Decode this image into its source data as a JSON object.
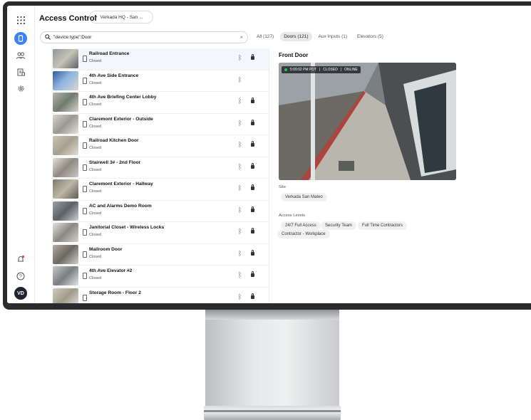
{
  "header": {
    "title": "Access Control",
    "site_selector": "Verkada HQ - San ..."
  },
  "search": {
    "value": "\"device type\":Door",
    "clear_symbol": "×"
  },
  "tabs": [
    {
      "label": "All (127)"
    },
    {
      "label": "Doors (121)"
    },
    {
      "label": "Aux Inputs (1)"
    },
    {
      "label": "Elevators (5)"
    }
  ],
  "sidebar": {
    "avatar_initials": "VD",
    "icons": [
      "apps-grid-icon",
      "access-control-icon",
      "users-icon",
      "reports-icon",
      "settings-icon",
      "alerts-icon",
      "help-icon"
    ]
  },
  "doors": [
    {
      "name": "Railroad Entrance",
      "status": "Closed",
      "locked": true
    },
    {
      "name": "4th Ave Side Entrance",
      "status": "Closed",
      "locked": false
    },
    {
      "name": "4th Ave Briefing Center Lobby",
      "status": "Closed",
      "locked": true
    },
    {
      "name": "Claremont Exterior - Outside",
      "status": "Closed",
      "locked": true
    },
    {
      "name": "Railroad Kitchen Door",
      "status": "Closed",
      "locked": true
    },
    {
      "name": "Stairwell 3# - 2nd Floor",
      "status": "Closed",
      "locked": true
    },
    {
      "name": "Claremont Exterior - Hallway",
      "status": "Closed",
      "locked": true
    },
    {
      "name": "AC and Alarms Demo Room",
      "status": "Closed",
      "locked": true
    },
    {
      "name": "Janitorial Closet - Wireless Locks",
      "status": "Closed",
      "locked": true
    },
    {
      "name": "Mailroom Door",
      "status": "Closed",
      "locked": true
    },
    {
      "name": "4th Ave Elevator #2",
      "status": "Closed",
      "locked": true
    },
    {
      "name": "Storage Room - Floor 2",
      "status": "",
      "locked": true
    }
  ],
  "detail": {
    "title": "Front Door",
    "camera_time": "5:09:02 PM PDT",
    "camera_state": "CLOSED",
    "camera_online": "ONLINE",
    "site_label": "Site",
    "site_value": "Verkada San Mateo",
    "access_levels_label": "Access Levels",
    "access_levels": [
      "24/7 Full Access",
      "Security Team",
      "Full Time Contractors",
      "Contractor - Workplace"
    ]
  },
  "colors": {
    "accent": "#3b82f6",
    "online_dot": "#22c55e",
    "bezel": "#2a2b2e"
  }
}
